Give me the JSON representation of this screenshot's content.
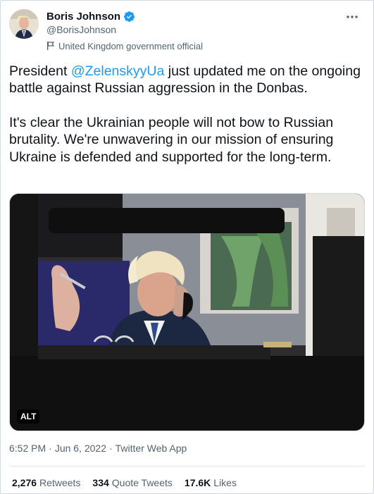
{
  "author": {
    "display_name": "Boris Johnson",
    "handle": "@BorisJohnson",
    "label": "United Kingdom government official",
    "verified": true
  },
  "tweet": {
    "line1_before": "President ",
    "mention": "@ZelenskyyUa",
    "line1_after": " just updated me on the ongoing battle against Russian aggression in the Donbas.",
    "paragraph2": "It's clear the Ukrainian people will not bow to Russian brutality. We're unwavering in our mission of ensuring Ukraine is defended and supported for the long-term."
  },
  "media": {
    "alt_label": "ALT"
  },
  "meta": {
    "time": "6:52 PM",
    "separator1": "·",
    "date": "Jun 6, 2022",
    "separator2": "·",
    "source": "Twitter Web App"
  },
  "stats": {
    "retweets_count": "2,276",
    "retweets_label": "Retweets",
    "quotes_count": "334",
    "quotes_label": "Quote Tweets",
    "likes_count": "17.6K",
    "likes_label": "Likes"
  },
  "colors": {
    "accent": "#1d9bf0",
    "text": "#0f1419",
    "secondary": "#536471"
  }
}
